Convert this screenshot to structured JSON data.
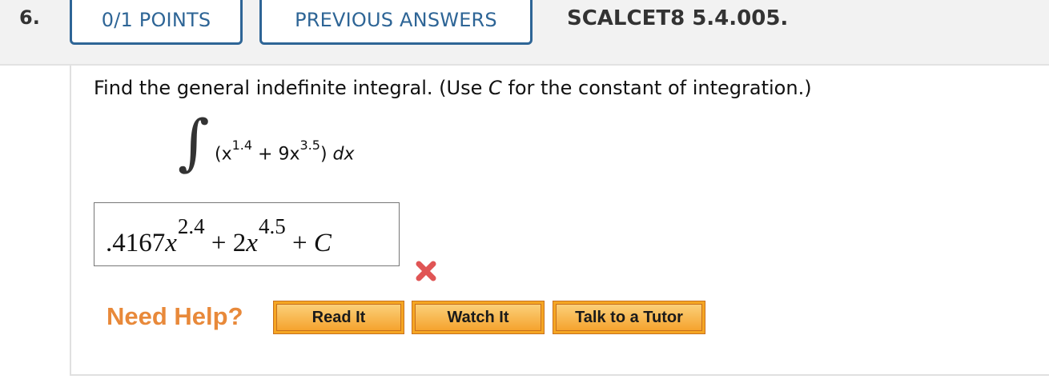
{
  "header": {
    "question_number": "6.",
    "points": "0/1 POINTS",
    "previous_answers": "PREVIOUS ANSWERS",
    "question_id": "SCALCET8 5.4.005."
  },
  "question": {
    "prompt_prefix": "Find the general indefinite integral. (Use ",
    "prompt_var": "C",
    "prompt_suffix": " for the constant of integration.)",
    "integral_symbol": "∫",
    "integrand_open": "(x",
    "exp1": "1.4",
    "integrand_mid": " + 9x",
    "exp2": "3.5",
    "integrand_close": ") ",
    "dx": "dx"
  },
  "answer": {
    "coef1": ".4167",
    "var1": "x",
    "exp1": "2.4",
    "mid": " + 2",
    "var2": "x",
    "exp2": "4.5",
    "plus": " + ",
    "const": "C",
    "status": "incorrect",
    "status_icon": "wrong-x-icon",
    "status_color": "#e05555"
  },
  "help": {
    "label": "Need Help?",
    "buttons": [
      "Read It",
      "Watch It",
      "Talk to a Tutor"
    ],
    "label_color": "#e8893a",
    "button_color": "#f5a623"
  },
  "colors": {
    "accent": "#2e6596"
  }
}
